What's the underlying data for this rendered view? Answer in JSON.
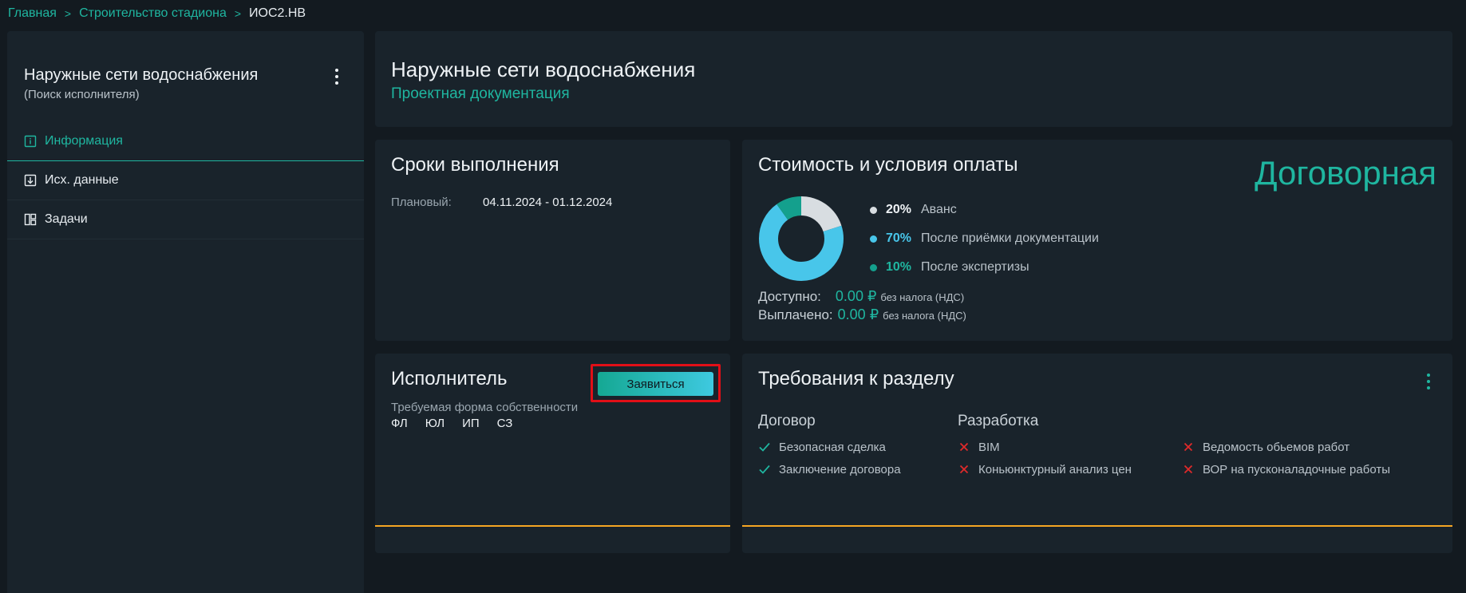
{
  "breadcrumb": {
    "home": "Главная",
    "project": "Строительство стадиона",
    "current": "ИОС2.НВ"
  },
  "sidebar": {
    "title": "Наружные сети водоснабжения",
    "subtitle": "(Поиск исполнителя)",
    "items": [
      {
        "label": "Информация",
        "icon": "info-icon",
        "active": true
      },
      {
        "label": "Исх. данные",
        "icon": "download-icon",
        "active": false
      },
      {
        "label": "Задачи",
        "icon": "kanban-icon",
        "active": false
      }
    ]
  },
  "header": {
    "title": "Наружные сети водоснабжения",
    "subtitle": "Проектная документация"
  },
  "schedule": {
    "title": "Сроки выполнения",
    "planned_label": "Плановый:",
    "planned_value": "04.11.2024 - 01.12.2024"
  },
  "cost": {
    "title": "Стоимость и условия оплаты",
    "price_type": "Договорная",
    "payments": [
      {
        "percent": "20%",
        "label": "Аванс",
        "share": 20,
        "color": "#d8dde1"
      },
      {
        "percent": "70%",
        "label": "После приёмки документации",
        "share": 70,
        "color": "#48c6ea"
      },
      {
        "percent": "10%",
        "label": "После экспертизы",
        "share": 10,
        "color": "#14a08d"
      }
    ],
    "available_label": "Доступно:",
    "available_value": "0.00 ₽",
    "paid_label": "Выплачено:",
    "paid_value": "0.00 ₽",
    "tax_note": "без налога (НДС)"
  },
  "executor": {
    "title": "Исполнитель",
    "apply_label": "Заявиться",
    "ownership_label": "Требуемая форма собственности",
    "forms": [
      "ФЛ",
      "ЮЛ",
      "ИП",
      "СЗ"
    ]
  },
  "requirements": {
    "title": "Требования к разделу",
    "contract_title": "Договор",
    "contract_items": [
      "Безопасная сделка",
      "Заключение договора"
    ],
    "dev_title": "Разработка",
    "dev_items_left": [
      "BIM",
      "Коньюнктурный анализ цен"
    ],
    "dev_items_right": [
      "Ведомость обьемов работ",
      "ВОР на пусконаладочные работы"
    ]
  },
  "colors": {
    "accent": "#1fb6a0",
    "background": "#131a20",
    "panel": "#19232b",
    "highlight": "#e10f17",
    "divider": "#f5a623",
    "fail": "#e02a2a"
  }
}
